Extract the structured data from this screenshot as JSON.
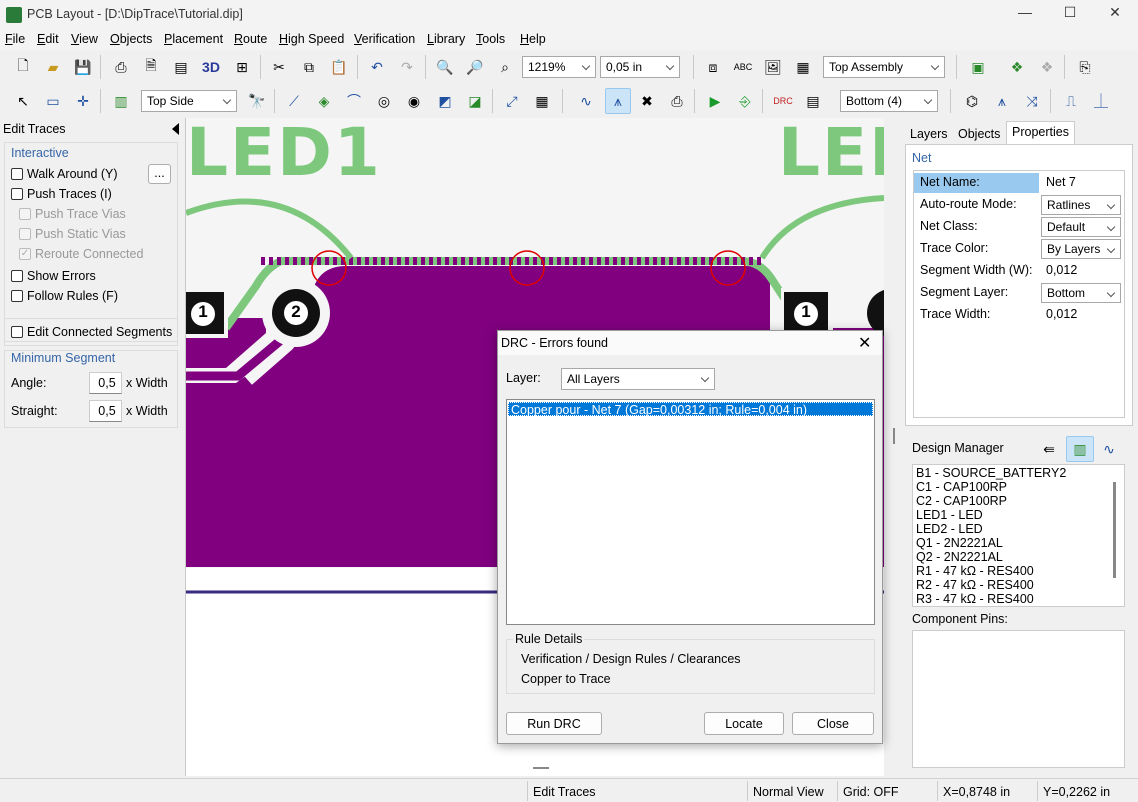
{
  "window": {
    "title": "PCB Layout - [D:\\DipTrace\\Tutorial.dip]",
    "app_icon": "pcb-app-icon"
  },
  "menu": [
    "File",
    "Edit",
    "View",
    "Objects",
    "Placement",
    "Route",
    "High Speed",
    "Verification",
    "Library",
    "Tools",
    "Help"
  ],
  "toolbar1": {
    "zoom": "1219%",
    "grid": "0,05 in",
    "assembly": "Top Assembly",
    "label_3d": "3D"
  },
  "toolbar2": {
    "side": "Top Side",
    "layer": "Bottom (4)"
  },
  "left_panel": {
    "title": "Edit Traces",
    "interactive_label": "Interactive",
    "walk_around": "Walk Around (Y)",
    "more_button": "...",
    "push_traces": "Push Traces (I)",
    "push_trace_vias": "Push Trace Vias",
    "push_static_vias": "Push Static Vias",
    "reroute_connected": "Reroute Connected",
    "show_errors": "Show Errors",
    "follow_rules": "Follow Rules (F)",
    "edit_connected": "Edit Connected Segments",
    "min_segment_label": "Minimum Segment",
    "angle_label": "Angle:",
    "angle_value": "0,5",
    "straight_label": "Straight:",
    "straight_value": "0,5",
    "x_width": "x Width"
  },
  "canvas": {
    "led1_label": "LED1",
    "led2_label": "LED",
    "pad1": "1",
    "pad2": "2",
    "pad3": "1",
    "colors": {
      "copper": "#800080",
      "trace": "#7dc87d",
      "silk": "#7dc87d",
      "error": "#e00000"
    }
  },
  "right_panel": {
    "tabs": [
      "Layers",
      "Objects",
      "Properties"
    ],
    "net_heading": "Net",
    "props": [
      {
        "key": "Net Name:",
        "value": "Net 7"
      },
      {
        "key": "Auto-route Mode:",
        "value": "Ratlines"
      },
      {
        "key": "Net Class:",
        "value": "Default"
      },
      {
        "key": "Trace Color:",
        "value": "By Layers"
      },
      {
        "key": "Segment Width (W):",
        "value": "0,012"
      },
      {
        "key": "Segment Layer:",
        "value": "Bottom"
      },
      {
        "key": "Trace Width:",
        "value": "0,012"
      }
    ],
    "design_manager": "Design Manager",
    "components": [
      "B1 - SOURCE_BATTERY2",
      "C1 - CAP100RP",
      "C2 - CAP100RP",
      "LED1 - LED",
      "LED2 - LED",
      "Q1 - 2N2221AL",
      "Q2 - 2N2221AL",
      "R1 - 47 kΩ - RES400",
      "R2 - 47 kΩ - RES400",
      "R3 - 47 kΩ - RES400"
    ],
    "component_pins": "Component Pins:"
  },
  "dialog": {
    "title": "DRC - Errors found",
    "layer_label": "Layer:",
    "layer_value": "All Layers",
    "error_item": "Copper pour - Net 7  (Gap=0,00312 in; Rule=0,004 in)",
    "rule_details": "Rule Details",
    "rule_path": "Verification / Design Rules / Clearances",
    "rule_type": "Copper to Trace",
    "run_drc": "Run DRC",
    "locate": "Locate",
    "close": "Close"
  },
  "status": {
    "mode": "Edit Traces",
    "view": "Normal View",
    "grid": "Grid: OFF",
    "x": "X=0,8748 in",
    "y": "Y=0,2262 in"
  }
}
